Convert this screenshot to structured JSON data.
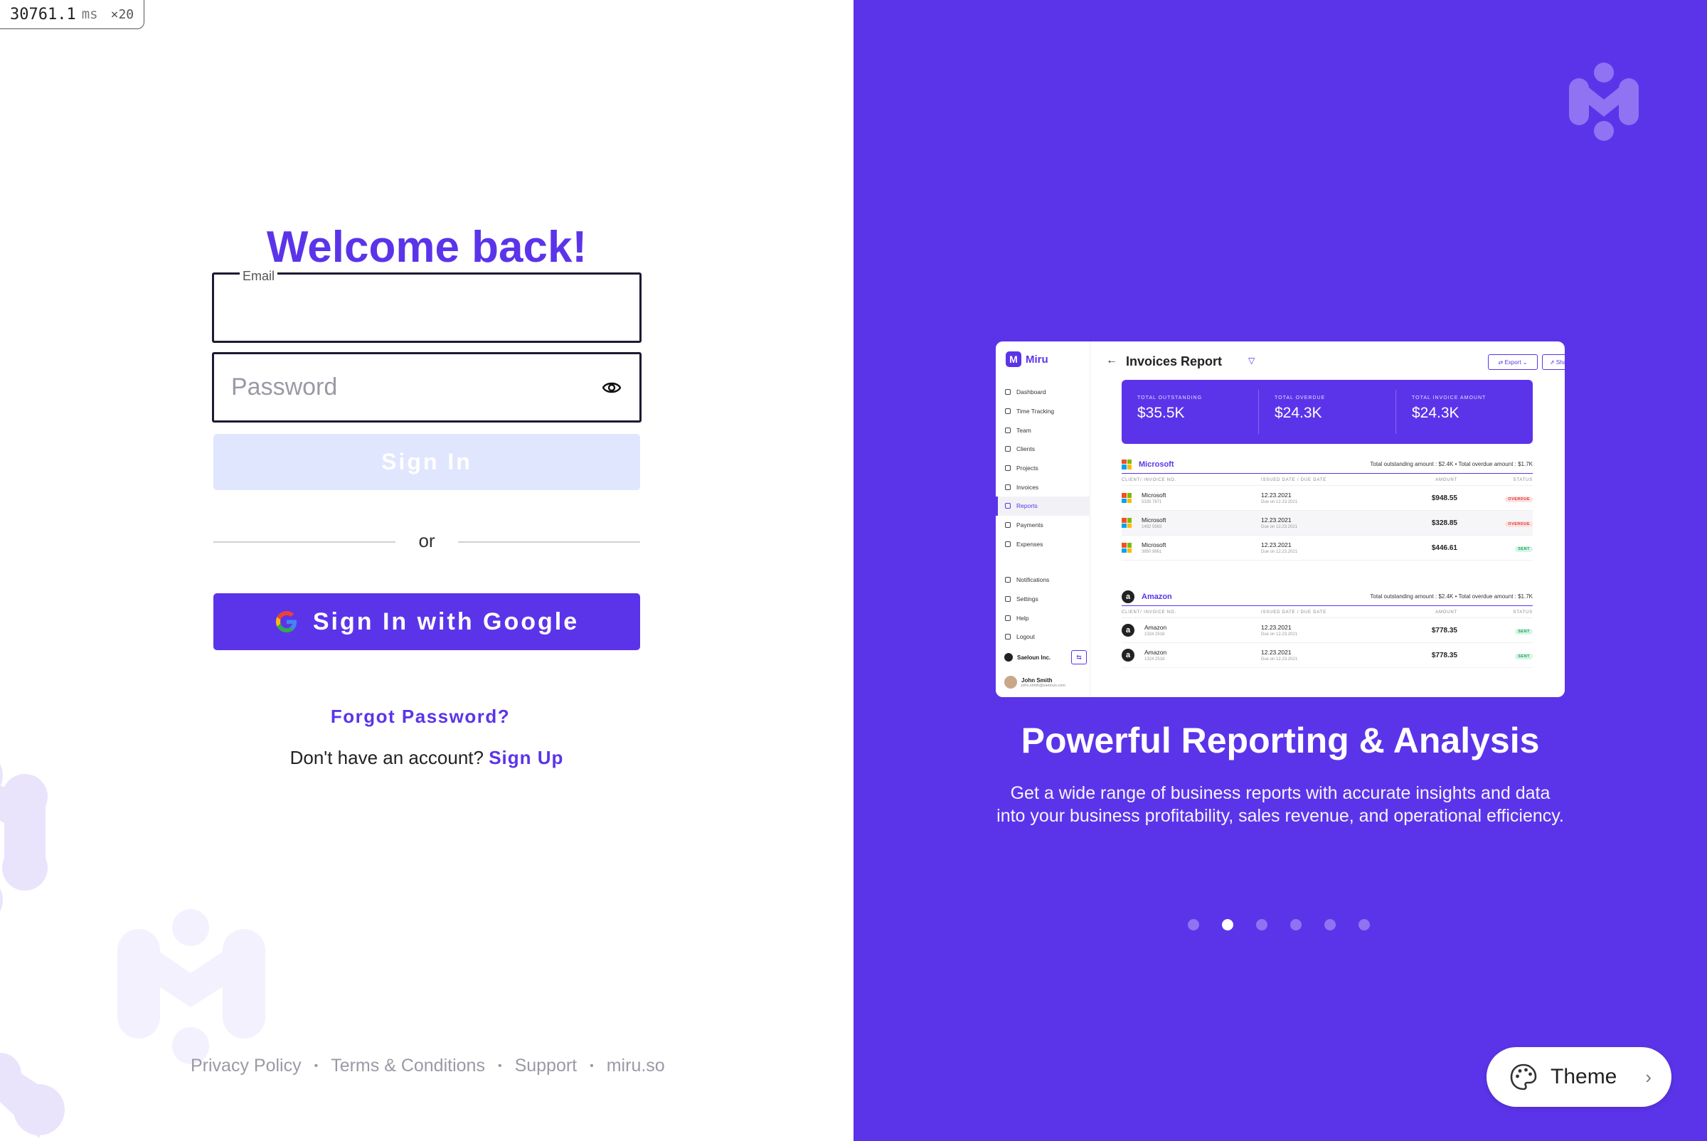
{
  "perf": {
    "value": "30761.1",
    "unit": "ms",
    "multiplier": "×20"
  },
  "login": {
    "heading": "Welcome back!",
    "email_label": "Email",
    "email_value": "",
    "password_placeholder": "Password",
    "password_value": "",
    "signin_label": "Sign In",
    "or_label": "or",
    "google_label": "Sign In with Google",
    "forgot_label": "Forgot Password?",
    "no_account_text": "Don't have an account?",
    "signup_label": "Sign Up"
  },
  "footer": {
    "links": [
      "Privacy Policy",
      "Terms & Conditions",
      "Support",
      "miru.so"
    ]
  },
  "preview": {
    "brand": "Miru",
    "title": "Invoices Report",
    "export_label": "Export",
    "share_label": "Share",
    "nav": [
      "Dashboard",
      "Time Tracking",
      "Team",
      "Clients",
      "Projects",
      "Invoices",
      "Reports",
      "Payments",
      "Expenses"
    ],
    "nav_bottom": [
      "Notifications",
      "Settings",
      "Help",
      "Logout"
    ],
    "org": "Saeloun Inc.",
    "user_name": "John Smith",
    "user_email": "john.smith@saeloun.com",
    "kpis": [
      {
        "label": "TOTAL OUTSTANDING",
        "value": "$35.5K"
      },
      {
        "label": "TOTAL OVERDUE",
        "value": "$24.3K"
      },
      {
        "label": "TOTAL INVOICE AMOUNT",
        "value": "$24.3K"
      }
    ],
    "columns": [
      "CLIENT/ INVOICE NO.",
      "ISSUED DATE / DUE DATE",
      "AMOUNT",
      "STATUS"
    ],
    "sections": [
      {
        "client": "Microsoft",
        "totals": "Total outstanding amount : $2.4K • Total overdue amount : $1.7K",
        "rows": [
          {
            "client": "Microsoft",
            "no": "5335 7871",
            "date": "12.23.2021",
            "due": "Due on 12.23.2021",
            "amount": "$948.55",
            "status": "OVERDUE"
          },
          {
            "client": "Microsoft",
            "no": "1492 5983",
            "date": "12.23.2021",
            "due": "Due on 12.23.2021",
            "amount": "$328.85",
            "status": "OVERDUE"
          },
          {
            "client": "Microsoft",
            "no": "3850 9861",
            "date": "12.23.2021",
            "due": "Due on 12.23.2021",
            "amount": "$446.61",
            "status": "SENT"
          }
        ]
      },
      {
        "client": "Amazon",
        "totals": "Total outstanding amount : $2.4K • Total overdue amount : $1.7K",
        "rows": [
          {
            "client": "Amazon",
            "no": "1324 2518",
            "date": "12.23.2021",
            "due": "Due on 12.23.2021",
            "amount": "$778.35",
            "status": "SENT"
          },
          {
            "client": "Amazon",
            "no": "1324 2518",
            "date": "12.23.2021",
            "due": "Due on 12.23.2021",
            "amount": "$778.35",
            "status": "SENT"
          }
        ]
      }
    ]
  },
  "feature": {
    "title": "Powerful Reporting & Analysis",
    "description_line1": "Get a wide range of business reports with accurate insights and data",
    "description_line2": "into your business profitability, sales revenue, and operational efficiency.",
    "carousel_count": 6,
    "carousel_active": 2
  },
  "theme": {
    "label": "Theme"
  },
  "colors": {
    "brand": "#5B34EA",
    "disabled_button": "#e0e6fd"
  }
}
